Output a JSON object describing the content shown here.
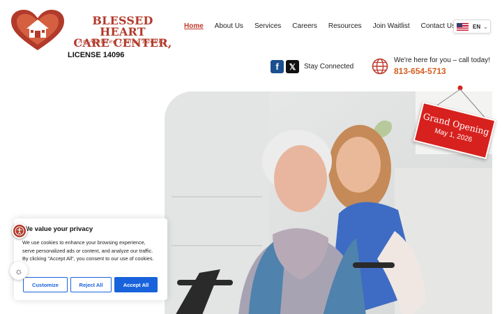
{
  "logo": {
    "title_line1": "BLESSED HEART",
    "title_line2": "CARE CENTER,",
    "subtitle": "An Assisted Living Facility",
    "license": "LICENSE 14096",
    "colors": {
      "brand_red": "#b23a2b"
    }
  },
  "nav": {
    "items": [
      {
        "label": "Home",
        "active": true
      },
      {
        "label": "About Us"
      },
      {
        "label": "Services"
      },
      {
        "label": "Careers"
      },
      {
        "label": "Resources"
      },
      {
        "label": "Join Waitlist"
      },
      {
        "label": "Contact Us"
      }
    ]
  },
  "language": {
    "code": "EN",
    "flag_icon": "us-flag-icon"
  },
  "social": {
    "label": "Stay Connected",
    "icons": [
      "facebook-icon",
      "x-icon"
    ]
  },
  "contact": {
    "tagline": "We're here for you – call today!",
    "phone": "813-654-5713",
    "icon": "globe-icon",
    "phone_color": "#d35d1f"
  },
  "hero": {
    "sign_title": "Grand Opening",
    "sign_date": "May 1, 2026"
  },
  "cookie": {
    "title": "We value your privacy",
    "text": "We use cookies to enhance your browsing experience, serve personalized ads or content, and analyze our traffic. By clicking \"Accept All\", you consent to our use of cookies.",
    "customize": "Customize",
    "reject": "Reject All",
    "accept": "Accept All",
    "accent": "#1863dc"
  },
  "widgets": {
    "accessibility_icon": "accessibility-icon",
    "theme_icon": "sun-icon"
  }
}
